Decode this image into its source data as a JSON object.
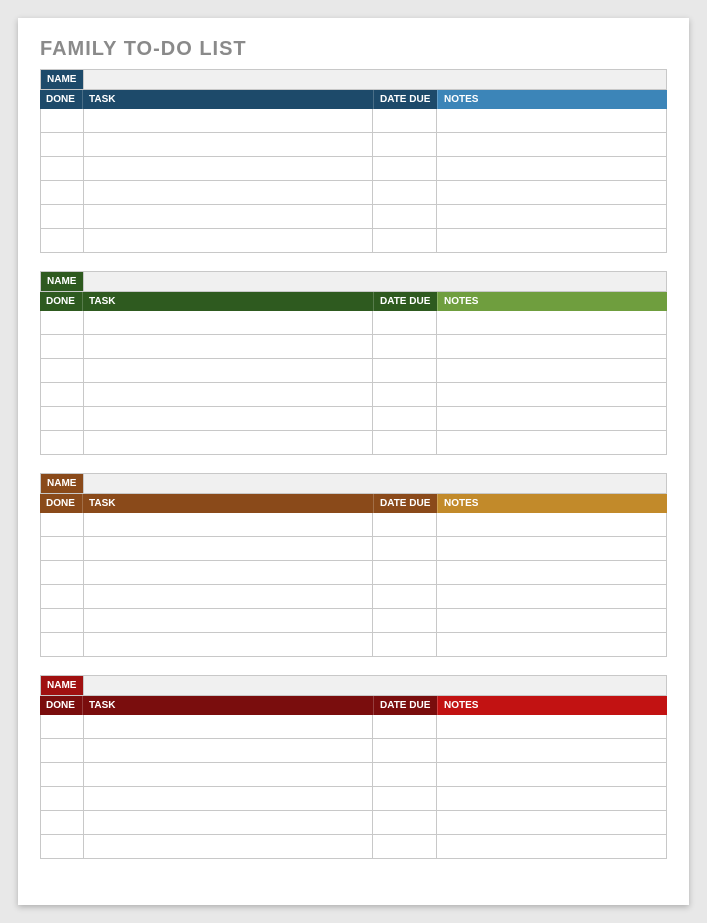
{
  "title": "FAMILY TO-DO LIST",
  "labels": {
    "name": "NAME",
    "done": "DONE",
    "task": "TASK",
    "date_due": "DATE DUE",
    "notes": "NOTES"
  },
  "sections": [
    {
      "name_color": "#1d4a6a",
      "left_color": "#1d4a6a",
      "right_color": "#3c85b8",
      "name_value": "",
      "rows": [
        {
          "done": "",
          "task": "",
          "date_due": "",
          "notes": ""
        },
        {
          "done": "",
          "task": "",
          "date_due": "",
          "notes": ""
        },
        {
          "done": "",
          "task": "",
          "date_due": "",
          "notes": ""
        },
        {
          "done": "",
          "task": "",
          "date_due": "",
          "notes": ""
        },
        {
          "done": "",
          "task": "",
          "date_due": "",
          "notes": ""
        },
        {
          "done": "",
          "task": "",
          "date_due": "",
          "notes": ""
        }
      ]
    },
    {
      "name_color": "#2e5a1f",
      "left_color": "#2e5a1f",
      "right_color": "#6f9e3e",
      "name_value": "",
      "rows": [
        {
          "done": "",
          "task": "",
          "date_due": "",
          "notes": ""
        },
        {
          "done": "",
          "task": "",
          "date_due": "",
          "notes": ""
        },
        {
          "done": "",
          "task": "",
          "date_due": "",
          "notes": ""
        },
        {
          "done": "",
          "task": "",
          "date_due": "",
          "notes": ""
        },
        {
          "done": "",
          "task": "",
          "date_due": "",
          "notes": ""
        },
        {
          "done": "",
          "task": "",
          "date_due": "",
          "notes": ""
        }
      ]
    },
    {
      "name_color": "#8a4a1a",
      "left_color": "#8a4a1a",
      "right_color": "#c28a2a",
      "name_value": "",
      "rows": [
        {
          "done": "",
          "task": "",
          "date_due": "",
          "notes": ""
        },
        {
          "done": "",
          "task": "",
          "date_due": "",
          "notes": ""
        },
        {
          "done": "",
          "task": "",
          "date_due": "",
          "notes": ""
        },
        {
          "done": "",
          "task": "",
          "date_due": "",
          "notes": ""
        },
        {
          "done": "",
          "task": "",
          "date_due": "",
          "notes": ""
        },
        {
          "done": "",
          "task": "",
          "date_due": "",
          "notes": ""
        }
      ]
    },
    {
      "name_color": "#a01010",
      "left_color": "#7a0d0d",
      "right_color": "#c21212",
      "name_value": "",
      "rows": [
        {
          "done": "",
          "task": "",
          "date_due": "",
          "notes": ""
        },
        {
          "done": "",
          "task": "",
          "date_due": "",
          "notes": ""
        },
        {
          "done": "",
          "task": "",
          "date_due": "",
          "notes": ""
        },
        {
          "done": "",
          "task": "",
          "date_due": "",
          "notes": ""
        },
        {
          "done": "",
          "task": "",
          "date_due": "",
          "notes": ""
        },
        {
          "done": "",
          "task": "",
          "date_due": "",
          "notes": ""
        }
      ]
    }
  ]
}
